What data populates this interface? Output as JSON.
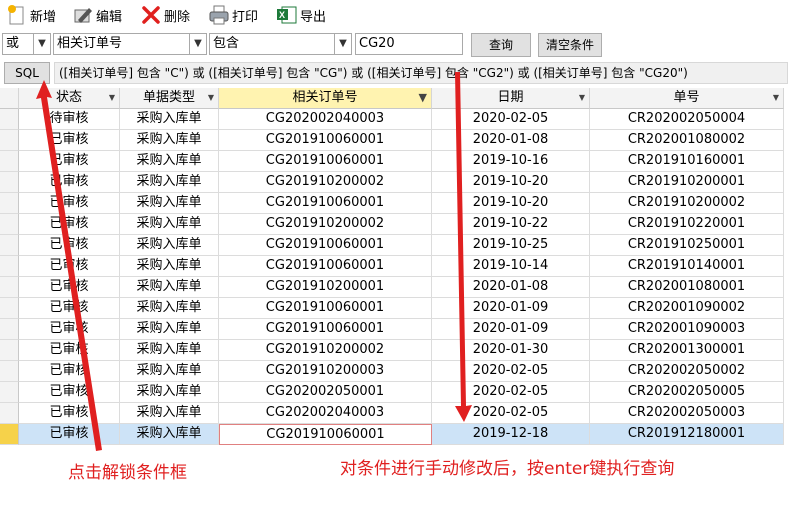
{
  "toolbar": {
    "new_label": "新增",
    "edit_label": "编辑",
    "delete_label": "删除",
    "print_label": "打印",
    "export_label": "导出"
  },
  "filter": {
    "logic_value": "或",
    "field_value": "相关订单号",
    "operator_value": "包含",
    "keyword_value": "CG20",
    "query_button": "查询",
    "clear_button": "清空条件"
  },
  "sql": {
    "button_label": "SQL",
    "expression": "([相关订单号] 包含 \"C\") 或 ([相关订单号] 包含 \"CG\") 或 ([相关订单号] 包含 \"CG2\") 或 ([相关订单号] 包含 \"CG20\")"
  },
  "table": {
    "columns": [
      "状态",
      "单据类型",
      "相关订单号",
      "日期",
      "单号"
    ],
    "rows": [
      [
        "待审核",
        "采购入库单",
        "CG202002040003",
        "2020-02-05",
        "CR202002050004"
      ],
      [
        "已审核",
        "采购入库单",
        "CG201910060001",
        "2020-01-08",
        "CR202001080002"
      ],
      [
        "已审核",
        "采购入库单",
        "CG201910060001",
        "2019-10-16",
        "CR201910160001"
      ],
      [
        "已审核",
        "采购入库单",
        "CG201910200002",
        "2019-10-20",
        "CR201910200001"
      ],
      [
        "已审核",
        "采购入库单",
        "CG201910060001",
        "2019-10-20",
        "CR201910200002"
      ],
      [
        "已审核",
        "采购入库单",
        "CG201910200002",
        "2019-10-22",
        "CR201910220001"
      ],
      [
        "已审核",
        "采购入库单",
        "CG201910060001",
        "2019-10-25",
        "CR201910250001"
      ],
      [
        "已审核",
        "采购入库单",
        "CG201910060001",
        "2019-10-14",
        "CR201910140001"
      ],
      [
        "已审核",
        "采购入库单",
        "CG201910200001",
        "2020-01-08",
        "CR202001080001"
      ],
      [
        "已审核",
        "采购入库单",
        "CG201910060001",
        "2020-01-09",
        "CR202001090002"
      ],
      [
        "已审核",
        "采购入库单",
        "CG201910060001",
        "2020-01-09",
        "CR202001090003"
      ],
      [
        "已审核",
        "采购入库单",
        "CG201910200002",
        "2020-01-30",
        "CR202001300001"
      ],
      [
        "已审核",
        "采购入库单",
        "CG201910200003",
        "2020-02-05",
        "CR202002050002"
      ],
      [
        "已审核",
        "采购入库单",
        "CG202002050001",
        "2020-02-05",
        "CR202002050005"
      ],
      [
        "已审核",
        "采购入库单",
        "CG202002040003",
        "2020-02-05",
        "CR202002050003"
      ],
      [
        "已审核",
        "采购入库单",
        "CG201910060001",
        "2019-12-18",
        "CR201912180001"
      ]
    ]
  },
  "annotations": {
    "left_note": "点击解锁条件框",
    "right_note": "对条件进行手动修改后，按enter键执行查询"
  },
  "colors": {
    "annotation": "#e02020",
    "selected_row": "#cde3f7",
    "filter_header": "#fff3b0"
  }
}
